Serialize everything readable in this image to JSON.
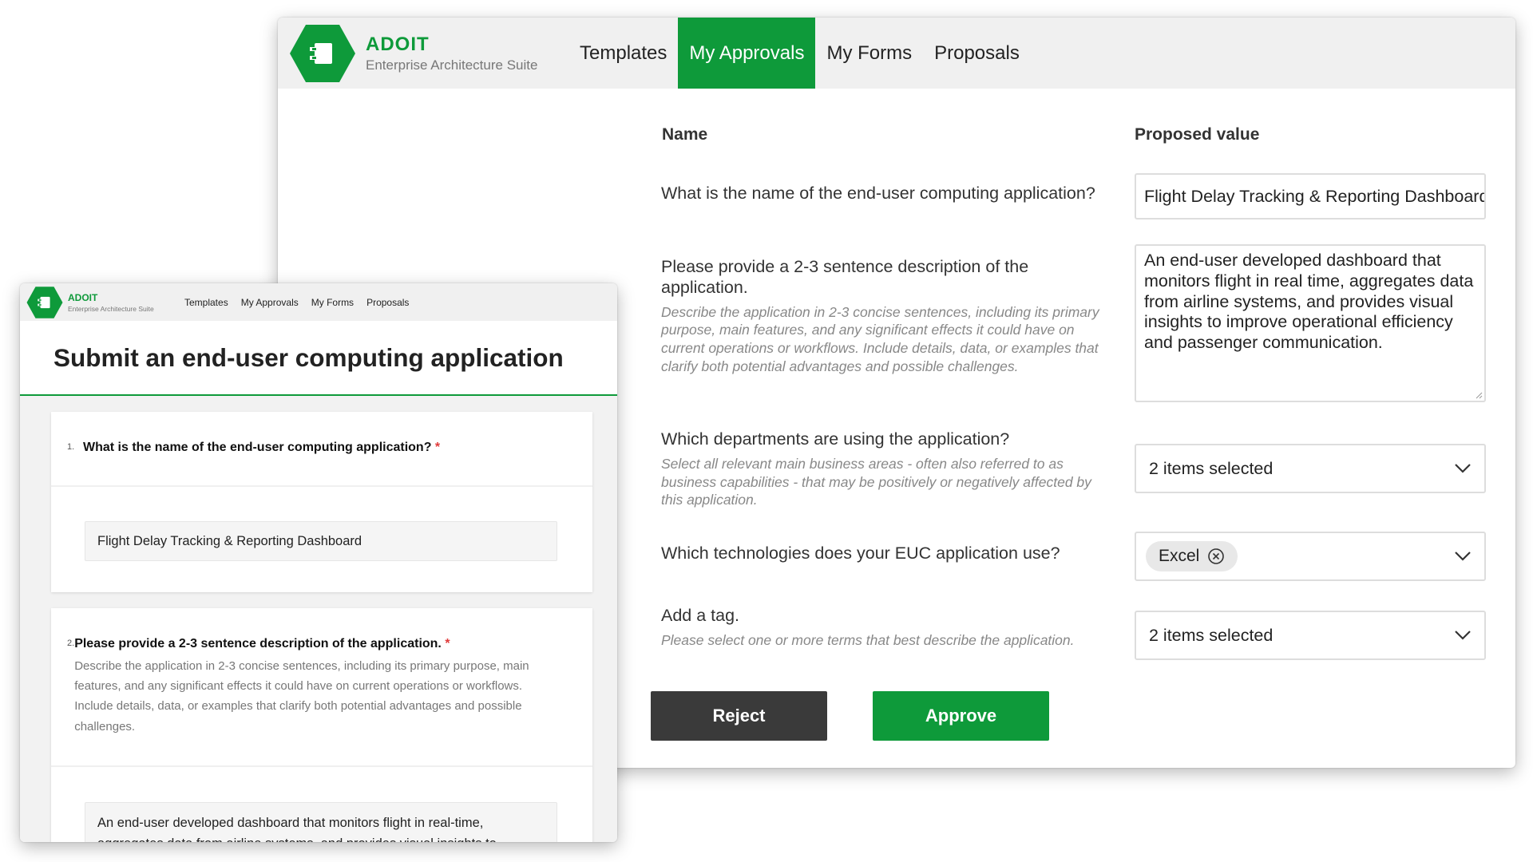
{
  "brand": {
    "name": "ADOIT",
    "subtitle": "Enterprise Architecture Suite",
    "color": "#0e9a3a",
    "icon": "adoit-hex-logo-icon"
  },
  "nav": {
    "items": [
      "Templates",
      "My Approvals",
      "My Forms",
      "Proposals"
    ],
    "active": "My Approvals"
  },
  "approval": {
    "col_name": "Name",
    "col_value": "Proposed value",
    "rows": [
      {
        "question": "What is the name of the end-user computing application?",
        "hint": "",
        "value": "Flight Delay Tracking & Reporting Dashboard"
      },
      {
        "question": "Please provide a 2-3 sentence description of the application.",
        "hint": "Describe the application in 2-3 concise sentences, including its primary purpose, main features, and any significant effects it could have on current operations or workflows. Include details, data, or examples that clarify both potential advantages and possible challenges.",
        "value": "An end-user developed dashboard that monitors flight in real time, aggregates data from airline systems, and provides visual insights to improve operational efficiency and passenger communication."
      },
      {
        "question": "Which departments are using the application?",
        "hint": "Select all relevant main business areas - often also referred to as business capabilities - that may be positively or negatively affected by this application.",
        "value": "2 items selected"
      },
      {
        "question": "Which technologies does your EUC application use?",
        "hint": "",
        "value": "Excel"
      },
      {
        "question": "Add a tag.",
        "hint": "Please select one or more terms that best describe the application.",
        "value": "2 items selected"
      }
    ],
    "reject_label": "Reject",
    "approve_label": "Approve",
    "reject_color": "#3a3a3a",
    "approve_color": "#0e9a3a"
  },
  "form": {
    "title": "Submit an end-user computing application",
    "q1": {
      "num": "1.",
      "title": "What is the name of the end-user computing application?",
      "required": "*",
      "value": "Flight Delay Tracking & Reporting Dashboard"
    },
    "q2": {
      "num": "2.",
      "title": "Please provide a 2-3 sentence description of the application.",
      "required": "*",
      "description": "Describe the application in 2-3 concise sentences, including its primary purpose, main features, and any significant effects it could have on current operations or workflows. Include details, data, or examples that clarify both potential advantages and possible challenges.",
      "value": "An end-user developed dashboard that monitors flight in real-time, aggregates data from airline systems, and provides visual insights to improve operational efficiency and passenger communication."
    }
  },
  "arrow_color": "#0c2d57"
}
